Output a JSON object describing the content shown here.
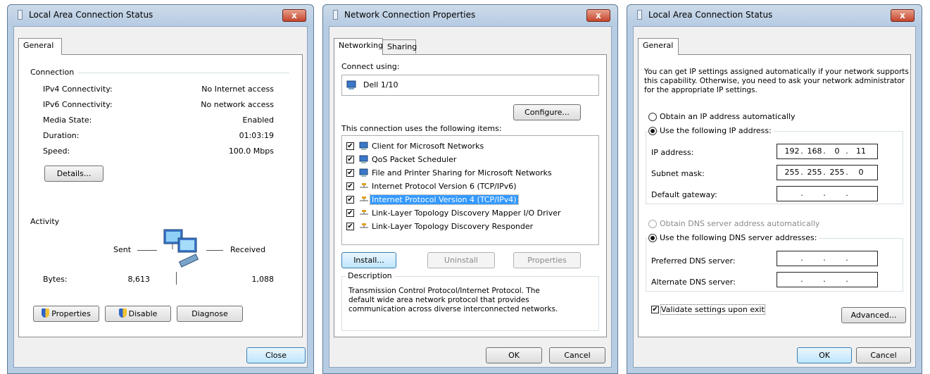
{
  "win1": {
    "title": "Local Area Connection Status",
    "close_glyph": "x",
    "tabs": [
      "General"
    ],
    "connection_heading": "Connection",
    "rows": [
      {
        "label": "IPv4 Connectivity:",
        "value": "No Internet access"
      },
      {
        "label": "IPv6 Connectivity:",
        "value": "No network access"
      },
      {
        "label": "Media State:",
        "value": "Enabled"
      },
      {
        "label": "Duration:",
        "value": "01:03:19"
      },
      {
        "label": "Speed:",
        "value": "100.0 Mbps"
      }
    ],
    "details_button": "Details...",
    "activity_heading": "Activity",
    "sent_label": "Sent",
    "received_label": "Received",
    "bytes_label": "Bytes:",
    "bytes_sent": "8,613",
    "bytes_received": "1,088",
    "properties_button": "Properties",
    "disable_button": "Disable",
    "diagnose_button": "Diagnose",
    "close_button": "Close"
  },
  "win2": {
    "title": "Network Connection Properties",
    "close_glyph": "x",
    "tabs": [
      "Networking",
      "Sharing"
    ],
    "connect_using_label": "Connect using:",
    "adapter_name": "Dell 1/10",
    "configure_button": "Configure...",
    "items_label": "This connection uses the following items:",
    "items": [
      {
        "label": "Client for Microsoft Networks",
        "checked": true,
        "icon": "network-client-icon"
      },
      {
        "label": "QoS Packet Scheduler",
        "checked": true,
        "icon": "network-service-icon"
      },
      {
        "label": "File and Printer Sharing for Microsoft Networks",
        "checked": true,
        "icon": "network-service-icon"
      },
      {
        "label": "Internet Protocol Version 6 (TCP/IPv6)",
        "checked": true,
        "icon": "protocol-icon"
      },
      {
        "label": "Internet Protocol Version 4 (TCP/IPv4)",
        "checked": true,
        "icon": "protocol-icon",
        "selected": true
      },
      {
        "label": "Link-Layer Topology Discovery Mapper I/O Driver",
        "checked": true,
        "icon": "protocol-icon"
      },
      {
        "label": "Link-Layer Topology Discovery Responder",
        "checked": true,
        "icon": "protocol-icon"
      }
    ],
    "install_button": "Install...",
    "uninstall_button": "Uninstall",
    "properties_button": "Properties",
    "description_heading": "Description",
    "description_text": "Transmission Control Protocol/Internet Protocol. The default wide area network protocol that provides communication across diverse interconnected networks.",
    "ok_button": "OK",
    "cancel_button": "Cancel"
  },
  "win3": {
    "title": "Local Area Connection Status",
    "close_glyph": "x",
    "tabs": [
      "General"
    ],
    "intro_text": "You can get IP settings assigned automatically if your network supports this capability. Otherwise, you need to ask your network administrator for the appropriate IP settings.",
    "obtain_ip_auto": "Obtain an IP address automatically",
    "use_following_ip": "Use the following IP address:",
    "ip_label": "IP address:",
    "ip_value": [
      "192",
      "168",
      "0",
      "11"
    ],
    "subnet_label": "Subnet mask:",
    "subnet_value": [
      "255",
      "255",
      "255",
      "0"
    ],
    "gateway_label": "Default gateway:",
    "obtain_dns_auto": "Obtain DNS server address automatically",
    "use_following_dns": "Use the following DNS server addresses:",
    "preferred_dns_label": "Preferred DNS server:",
    "alternate_dns_label": "Alternate DNS server:",
    "validate_label": "Validate settings upon exit",
    "advanced_button": "Advanced...",
    "ok_button": "OK",
    "cancel_button": "Cancel"
  }
}
